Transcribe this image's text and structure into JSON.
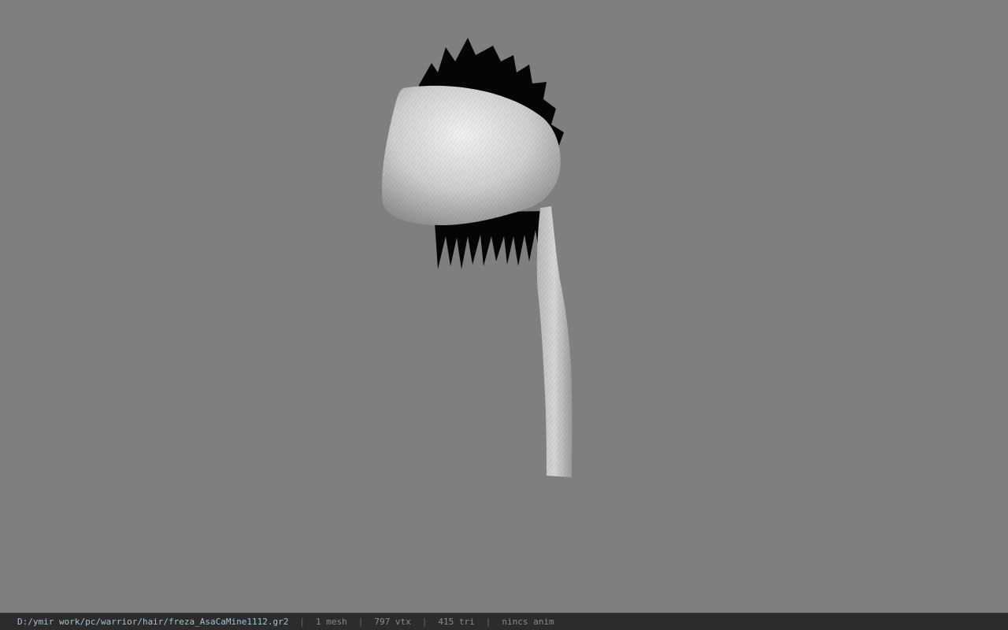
{
  "viewport": {
    "background": "#7f7f7f",
    "model_icon": "hair-bandana-model"
  },
  "status": {
    "path": "D:/ymir work/pc/warrior/hair/freza_AsaCaMine1112.gr2",
    "separator": "|",
    "meshes": "1 mesh",
    "vertices": "797 vtx",
    "triangles": "415 tri",
    "animation": "nincs anim"
  }
}
